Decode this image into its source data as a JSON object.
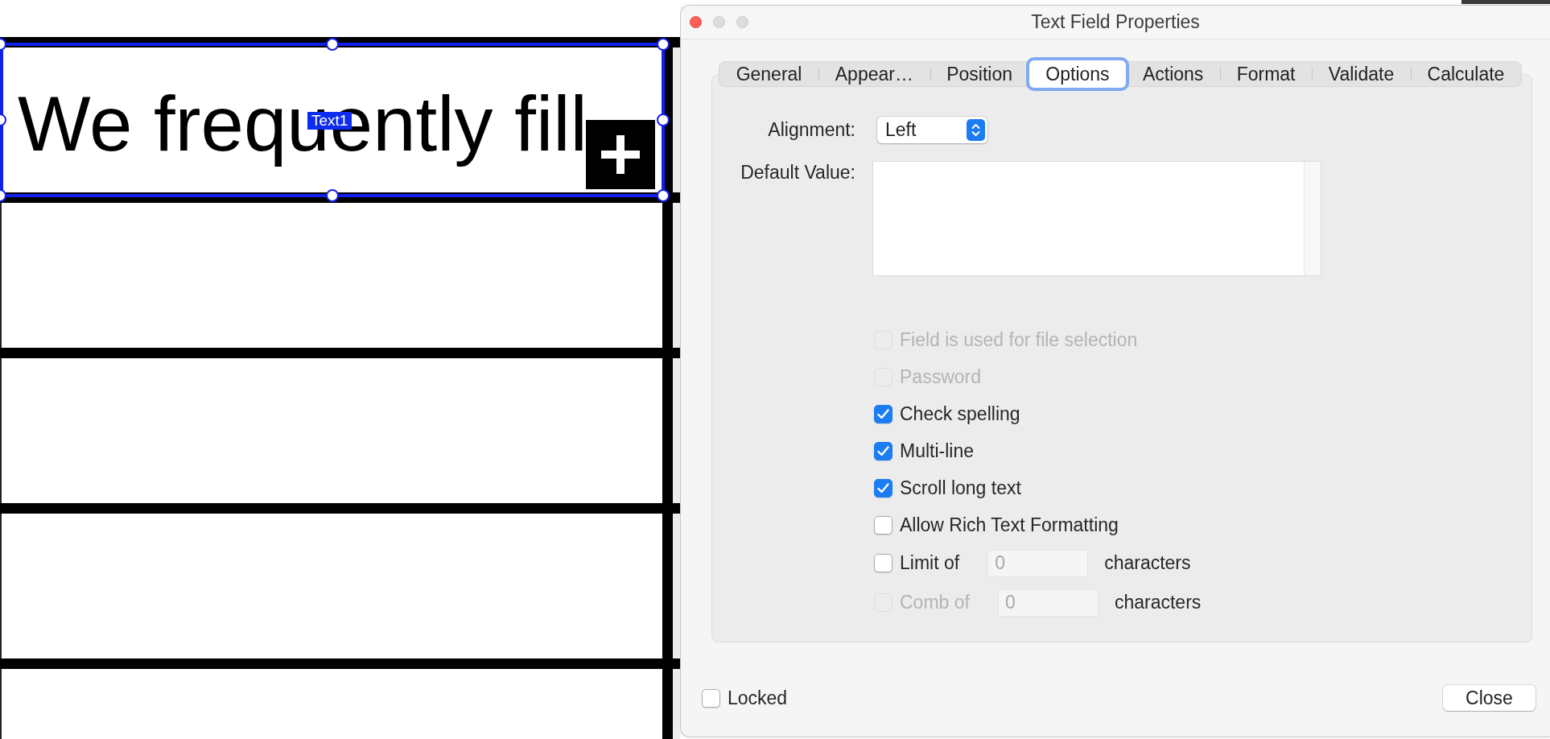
{
  "document": {
    "text_field": {
      "value": "We frequently fill",
      "name": "Text1",
      "selected": true,
      "overflow": true
    }
  },
  "dialog": {
    "title": "Text Field Properties",
    "tabs": [
      {
        "label": "General",
        "selected": false
      },
      {
        "label": "Appear…",
        "selected": false
      },
      {
        "label": "Position",
        "selected": false
      },
      {
        "label": "Options",
        "selected": true
      },
      {
        "label": "Actions",
        "selected": false
      },
      {
        "label": "Format",
        "selected": false
      },
      {
        "label": "Validate",
        "selected": false
      },
      {
        "label": "Calculate",
        "selected": false
      }
    ],
    "alignment": {
      "label": "Alignment:",
      "value": "Left"
    },
    "default_value": {
      "label": "Default Value:"
    },
    "options": [
      {
        "kind": "checkbox",
        "label": "Field is used for file selection",
        "checked": false,
        "disabled": true
      },
      {
        "kind": "checkbox",
        "label": "Password",
        "checked": false,
        "disabled": true
      },
      {
        "kind": "checkbox",
        "label": "Check spelling",
        "checked": true,
        "disabled": false
      },
      {
        "kind": "checkbox",
        "label": "Multi-line",
        "checked": true,
        "disabled": false
      },
      {
        "kind": "checkbox",
        "label": "Scroll long text",
        "checked": true,
        "disabled": false
      },
      {
        "kind": "checkbox",
        "label": "Allow Rich Text Formatting",
        "checked": false,
        "disabled": false
      },
      {
        "kind": "limit",
        "label": "Limit of",
        "checked": false,
        "disabled": false,
        "placeholder": "0",
        "suffix": "characters"
      },
      {
        "kind": "limit",
        "label": "Comb of",
        "checked": false,
        "disabled": true,
        "placeholder": "0",
        "suffix": "characters"
      }
    ],
    "locked": {
      "label": "Locked",
      "checked": false
    },
    "close_button": {
      "label": "Close"
    }
  }
}
